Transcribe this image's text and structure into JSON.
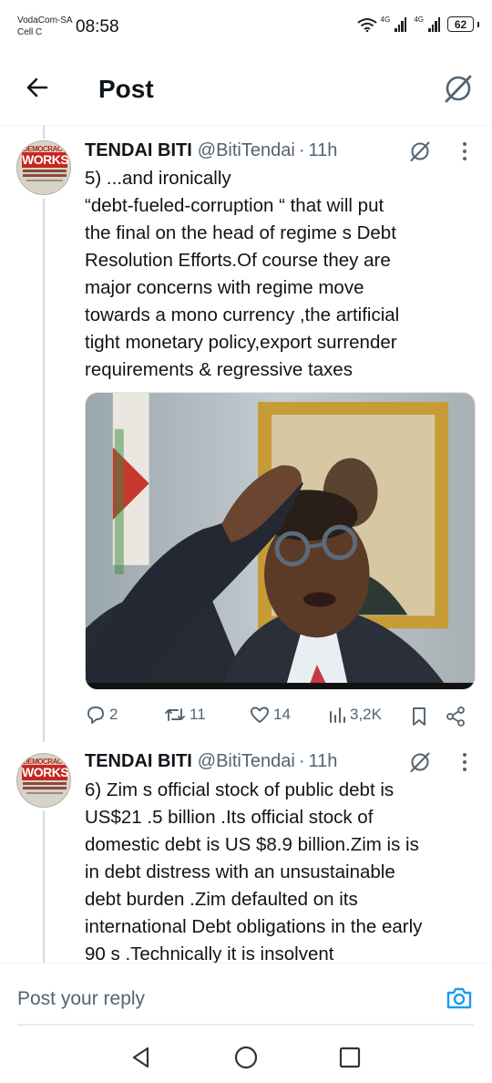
{
  "status_bar": {
    "carrier_line1": "VodaCom-SA",
    "carrier_line2": "Cell C",
    "time": "08:58",
    "sim1_label": "4G",
    "sim2_label": "4G",
    "battery": "62"
  },
  "header": {
    "title": "Post"
  },
  "tweets": [
    {
      "author": "TENDAI BITI",
      "handle": "@BitiTendai",
      "separator": "·",
      "time": "11h",
      "avatar_text_top": "DEMOCRACY",
      "avatar_text_main": "WORKS",
      "lines": [
        "5) ...and ironically",
        "“debt-fueled-corruption “ that will put",
        "the final on the head of regime s Debt",
        "Resolution Efforts.Of course they are",
        "major concerns with regime move",
        "towards a mono currency ,the artificial",
        "tight monetary policy,export surrender",
        "requirements & regressive taxes"
      ],
      "actions": {
        "replies": "2",
        "reposts": "11",
        "likes": "14",
        "views": "3,2K"
      }
    },
    {
      "author": "TENDAI BITI",
      "handle": "@BitiTendai",
      "separator": "·",
      "time": "11h",
      "avatar_text_top": "DEMOCRACY",
      "avatar_text_main": "WORKS",
      "lines": [
        "6) Zim s official stock of public debt is",
        "US$21 .5 billion .Its official stock of",
        "domestic debt is US $8.9 billion.Zim is is",
        "in debt distress with an unsustainable",
        "debt burden .Zim defaulted on its",
        "international Debt obligations in the early",
        "90 s .Technically it is insolvent"
      ]
    }
  ],
  "reply": {
    "placeholder": "Post your reply"
  },
  "icons": {
    "back": "arrow-left-icon",
    "grok": "grok-icon",
    "more": "more-vertical-icon",
    "reply": "reply-bubble-icon",
    "repost": "repost-icon",
    "like": "heart-icon",
    "views": "views-bars-icon",
    "bookmark": "bookmark-icon",
    "share": "share-icon",
    "camera": "camera-icon",
    "nav_back": "triangle-back-icon",
    "nav_home": "circle-home-icon",
    "nav_recents": "square-recents-icon"
  },
  "colors": {
    "accent": "#1d9bf0",
    "text": "#0f1419",
    "muted": "#536471",
    "divider": "#eff3f4"
  }
}
